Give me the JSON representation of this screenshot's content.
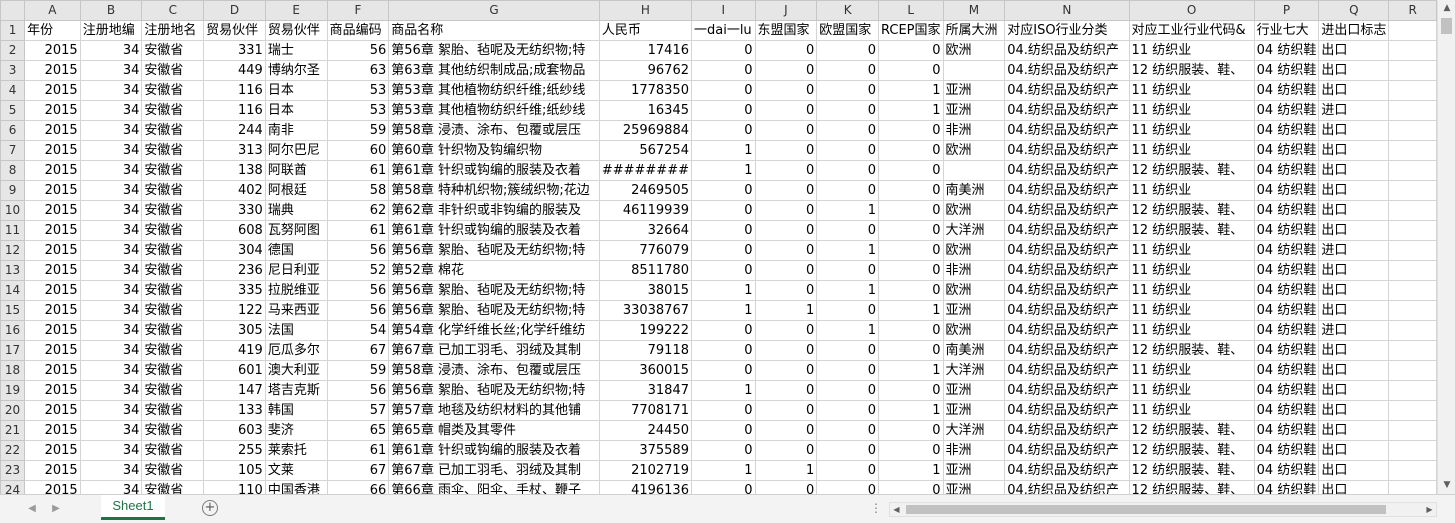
{
  "columns": [
    "A",
    "B",
    "C",
    "D",
    "E",
    "F",
    "G",
    "H",
    "I",
    "J",
    "K",
    "L",
    "M",
    "N",
    "O",
    "P",
    "Q",
    "R"
  ],
  "header_row_number": "1",
  "headers": [
    "年份",
    "注册地编",
    "注册地名",
    "贸易伙伴",
    "贸易伙伴",
    "商品编码",
    "商品名称",
    "人民币",
    "一dai一lu",
    "东盟国家",
    "欧盟国家",
    "RCEP国家",
    "所属大洲",
    "对应ISO行业分类",
    "对应工业行业代码&",
    "行业七大",
    "进出口标志",
    ""
  ],
  "rows": [
    {
      "n": "2",
      "c": [
        "2015",
        "34",
        "安徽省",
        "331",
        "瑞士",
        "56",
        "第56章 絮胎、毡呢及无纺织物;特",
        "17416",
        "0",
        "0",
        "0",
        "0",
        "欧洲",
        "04.纺织品及纺织产",
        "11 纺织业",
        "04 纺织鞋",
        "出口",
        ""
      ]
    },
    {
      "n": "3",
      "c": [
        "2015",
        "34",
        "安徽省",
        "449",
        "博纳尔圣",
        "63",
        "第63章 其他纺织制成品;成套物品",
        "96762",
        "0",
        "0",
        "0",
        "0",
        "",
        "04.纺织品及纺织产",
        "12 纺织服装、鞋、",
        "04 纺织鞋",
        "出口",
        ""
      ]
    },
    {
      "n": "4",
      "c": [
        "2015",
        "34",
        "安徽省",
        "116",
        "日本",
        "53",
        "第53章 其他植物纺织纤维;纸纱线",
        "1778350",
        "0",
        "0",
        "0",
        "1",
        "亚洲",
        "04.纺织品及纺织产",
        "11 纺织业",
        "04 纺织鞋",
        "出口",
        ""
      ]
    },
    {
      "n": "5",
      "c": [
        "2015",
        "34",
        "安徽省",
        "116",
        "日本",
        "53",
        "第53章 其他植物纺织纤维;纸纱线",
        "16345",
        "0",
        "0",
        "0",
        "1",
        "亚洲",
        "04.纺织品及纺织产",
        "11 纺织业",
        "04 纺织鞋",
        "进口",
        ""
      ]
    },
    {
      "n": "6",
      "c": [
        "2015",
        "34",
        "安徽省",
        "244",
        "南非",
        "59",
        "第58章 浸渍、涂布、包覆或层压",
        "25969884",
        "0",
        "0",
        "0",
        "0",
        "非洲",
        "04.纺织品及纺织产",
        "11 纺织业",
        "04 纺织鞋",
        "出口",
        ""
      ]
    },
    {
      "n": "7",
      "c": [
        "2015",
        "34",
        "安徽省",
        "313",
        "阿尔巴尼",
        "60",
        "第60章 针织物及钩编织物",
        "567254",
        "1",
        "0",
        "0",
        "0",
        "欧洲",
        "04.纺织品及纺织产",
        "11 纺织业",
        "04 纺织鞋",
        "出口",
        ""
      ]
    },
    {
      "n": "8",
      "c": [
        "2015",
        "34",
        "安徽省",
        "138",
        "阿联酋",
        "61",
        "第61章 针织或钩编的服装及衣着",
        "########",
        "1",
        "0",
        "0",
        "0",
        "",
        "04.纺织品及纺织产",
        "12 纺织服装、鞋、",
        "04 纺织鞋",
        "出口",
        ""
      ]
    },
    {
      "n": "9",
      "c": [
        "2015",
        "34",
        "安徽省",
        "402",
        "阿根廷",
        "58",
        "第58章 特种机织物;簇绒织物;花边",
        "2469505",
        "0",
        "0",
        "0",
        "0",
        "南美洲",
        "04.纺织品及纺织产",
        "11 纺织业",
        "04 纺织鞋",
        "出口",
        ""
      ]
    },
    {
      "n": "10",
      "c": [
        "2015",
        "34",
        "安徽省",
        "330",
        "瑞典",
        "62",
        "第62章 非针织或非钩编的服装及",
        "46119939",
        "0",
        "0",
        "1",
        "0",
        "欧洲",
        "04.纺织品及纺织产",
        "12 纺织服装、鞋、",
        "04 纺织鞋",
        "出口",
        ""
      ]
    },
    {
      "n": "11",
      "c": [
        "2015",
        "34",
        "安徽省",
        "608",
        "瓦努阿图",
        "61",
        "第61章 针织或钩编的服装及衣着",
        "32664",
        "0",
        "0",
        "0",
        "0",
        "大洋洲",
        "04.纺织品及纺织产",
        "12 纺织服装、鞋、",
        "04 纺织鞋",
        "出口",
        ""
      ]
    },
    {
      "n": "12",
      "c": [
        "2015",
        "34",
        "安徽省",
        "304",
        "德国",
        "56",
        "第56章 絮胎、毡呢及无纺织物;特",
        "776079",
        "0",
        "0",
        "1",
        "0",
        "欧洲",
        "04.纺织品及纺织产",
        "11 纺织业",
        "04 纺织鞋",
        "进口",
        ""
      ]
    },
    {
      "n": "13",
      "c": [
        "2015",
        "34",
        "安徽省",
        "236",
        "尼日利亚",
        "52",
        "第52章 棉花",
        "8511780",
        "0",
        "0",
        "0",
        "0",
        "非洲",
        "04.纺织品及纺织产",
        "11 纺织业",
        "04 纺织鞋",
        "出口",
        ""
      ]
    },
    {
      "n": "14",
      "c": [
        "2015",
        "34",
        "安徽省",
        "335",
        "拉脱维亚",
        "56",
        "第56章 絮胎、毡呢及无纺织物;特",
        "38015",
        "1",
        "0",
        "1",
        "0",
        "欧洲",
        "04.纺织品及纺织产",
        "11 纺织业",
        "04 纺织鞋",
        "出口",
        ""
      ]
    },
    {
      "n": "15",
      "c": [
        "2015",
        "34",
        "安徽省",
        "122",
        "马来西亚",
        "56",
        "第56章 絮胎、毡呢及无纺织物;特",
        "33038767",
        "1",
        "1",
        "0",
        "1",
        "亚洲",
        "04.纺织品及纺织产",
        "11 纺织业",
        "04 纺织鞋",
        "出口",
        ""
      ]
    },
    {
      "n": "16",
      "c": [
        "2015",
        "34",
        "安徽省",
        "305",
        "法国",
        "54",
        "第54章 化学纤维长丝;化学纤维纺",
        "199222",
        "0",
        "0",
        "1",
        "0",
        "欧洲",
        "04.纺织品及纺织产",
        "11 纺织业",
        "04 纺织鞋",
        "进口",
        ""
      ]
    },
    {
      "n": "17",
      "c": [
        "2015",
        "34",
        "安徽省",
        "419",
        "厄瓜多尔",
        "67",
        "第67章 已加工羽毛、羽绒及其制",
        "79118",
        "0",
        "0",
        "0",
        "0",
        "南美洲",
        "04.纺织品及纺织产",
        "12 纺织服装、鞋、",
        "04 纺织鞋",
        "出口",
        ""
      ]
    },
    {
      "n": "18",
      "c": [
        "2015",
        "34",
        "安徽省",
        "601",
        "澳大利亚",
        "59",
        "第58章 浸渍、涂布、包覆或层压",
        "360015",
        "0",
        "0",
        "0",
        "1",
        "大洋洲",
        "04.纺织品及纺织产",
        "11 纺织业",
        "04 纺织鞋",
        "出口",
        ""
      ]
    },
    {
      "n": "19",
      "c": [
        "2015",
        "34",
        "安徽省",
        "147",
        "塔吉克斯",
        "56",
        "第56章 絮胎、毡呢及无纺织物;特",
        "31847",
        "1",
        "0",
        "0",
        "0",
        "亚洲",
        "04.纺织品及纺织产",
        "11 纺织业",
        "04 纺织鞋",
        "出口",
        ""
      ]
    },
    {
      "n": "20",
      "c": [
        "2015",
        "34",
        "安徽省",
        "133",
        "韩国",
        "57",
        "第57章 地毯及纺织材料的其他铺",
        "7708171",
        "0",
        "0",
        "0",
        "1",
        "亚洲",
        "04.纺织品及纺织产",
        "11 纺织业",
        "04 纺织鞋",
        "出口",
        ""
      ]
    },
    {
      "n": "21",
      "c": [
        "2015",
        "34",
        "安徽省",
        "603",
        "斐济",
        "65",
        "第65章 帽类及其零件",
        "24450",
        "0",
        "0",
        "0",
        "0",
        "大洋洲",
        "04.纺织品及纺织产",
        "12 纺织服装、鞋、",
        "04 纺织鞋",
        "出口",
        ""
      ]
    },
    {
      "n": "22",
      "c": [
        "2015",
        "34",
        "安徽省",
        "255",
        "莱索托",
        "61",
        "第61章 针织或钩编的服装及衣着",
        "375589",
        "0",
        "0",
        "0",
        "0",
        "非洲",
        "04.纺织品及纺织产",
        "12 纺织服装、鞋、",
        "04 纺织鞋",
        "出口",
        ""
      ]
    },
    {
      "n": "23",
      "c": [
        "2015",
        "34",
        "安徽省",
        "105",
        "文莱",
        "67",
        "第67章 已加工羽毛、羽绒及其制",
        "2102719",
        "1",
        "1",
        "0",
        "1",
        "亚洲",
        "04.纺织品及纺织产",
        "12 纺织服装、鞋、",
        "04 纺织鞋",
        "出口",
        ""
      ]
    },
    {
      "n": "24",
      "c": [
        "2015",
        "34",
        "安徽省",
        "110",
        "中国香港",
        "66",
        "第66章 雨伞、阳伞、手杖、鞭子",
        "4196136",
        "0",
        "0",
        "0",
        "0",
        "亚洲",
        "04.纺织品及纺织产",
        "12 纺织服装、鞋、",
        "04 纺织鞋",
        "出口",
        ""
      ]
    }
  ],
  "sheet_tab": "Sheet1",
  "add_sheet": "+",
  "ellipsis": "⋮",
  "nav_prev": "◀",
  "nav_next": "▶",
  "scroll_up": "▲",
  "scroll_down": "▼"
}
